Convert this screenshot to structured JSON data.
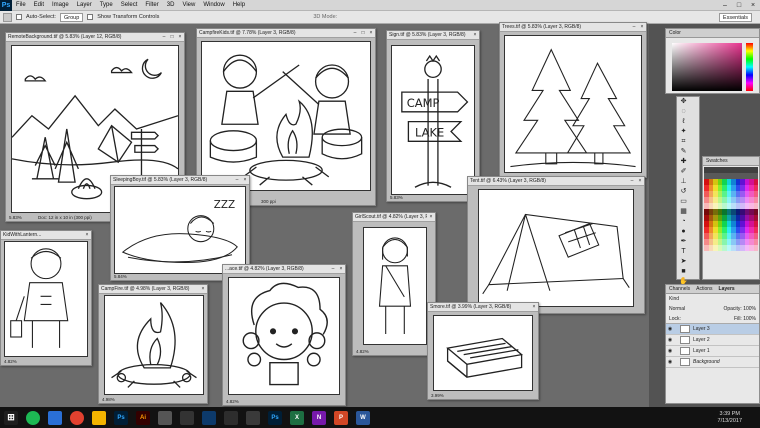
{
  "menubar": {
    "logo": "Ps",
    "items": [
      "File",
      "Edit",
      "Image",
      "Layer",
      "Type",
      "Select",
      "Filter",
      "3D",
      "View",
      "Window",
      "Help"
    ]
  },
  "options": {
    "auto_select": "Auto-Select:",
    "group": "Group",
    "transform": "Show Transform Controls",
    "mode": "3D Mode:",
    "workspace": "Essentials"
  },
  "documents": [
    {
      "title": "RemoteBackground.tif @ 5.83% (Layer 12, RGB/8)",
      "zoom": "5.83%",
      "info": "Doc: 12 in x 10 in (300 ppi)"
    },
    {
      "title": "CampfireKids.tif @ 7.78% (Layer 3, RGB/8)",
      "zoom": "7.78%",
      "info": "300 ppi"
    },
    {
      "title": "Sign.tif @ 5.83% (Layer 3, RGB/8)",
      "zoom": "5.83%"
    },
    {
      "title": "Trees.tif @ 5.83% (Layer 3, RGB/8)",
      "zoom": "5.83%"
    },
    {
      "title": "SleepingBoy.tif @ 5.83% (Layer 3, RGB/8)",
      "zoom": "5.84%"
    },
    {
      "title": "KidWithLantern...",
      "zoom": "4.82%"
    },
    {
      "title": "GirlScout.tif @ 4.82% (Layer 3, RGB/8)",
      "zoom": "4.82%"
    },
    {
      "title": "Tent.tif @ 6.43% (Layer 3, RGB/8)",
      "zoom": "6.43%"
    },
    {
      "title": "CampFire.tif @ 4.98% (Layer 3, RGB/8)",
      "zoom": "4.98%"
    },
    {
      "title": "...ace.tif @ 4.82% (Layer 3, RGB/8)",
      "zoom": "4.82%"
    },
    {
      "title": "Smore.tif @ 3.99% (Layer 3, RGB/8)",
      "zoom": "3.99%"
    }
  ],
  "sign_text": {
    "top": "CAMP",
    "bottom": "LAKE"
  },
  "sleep_text": "ZZZ",
  "panels": {
    "color_tab": "Color",
    "swatch_tab": "Swatches",
    "layers_tabs": [
      "Channels",
      "Actions",
      "Layers"
    ],
    "kind": "Kind",
    "normal": "Normal",
    "opacity": "Opacity: 100%",
    "lock": "Lock:",
    "fill": "Fill: 100%",
    "layers": [
      "Layer 3",
      "Layer 2",
      "Layer 1",
      "Background"
    ]
  },
  "taskbar": {
    "icons": [
      "Ps",
      "Ai",
      "Ps",
      "X",
      "N",
      "P",
      "W"
    ],
    "time": "3:39 PM",
    "date": "7/13/2017"
  },
  "colors": {
    "accent": "#31a8ff",
    "fg": "#e83a8f"
  }
}
